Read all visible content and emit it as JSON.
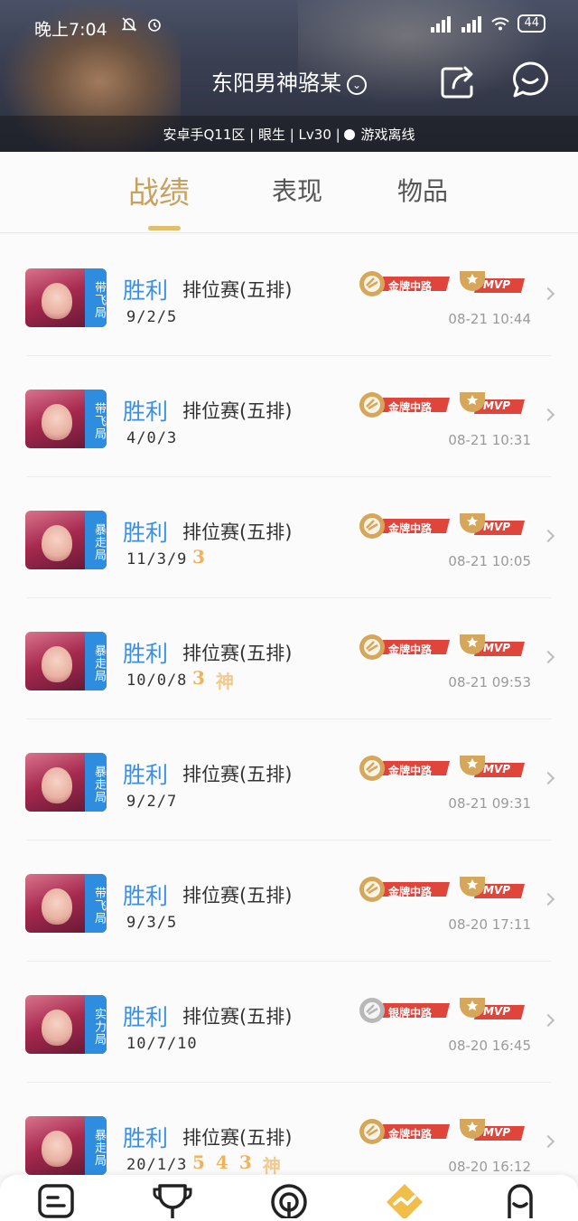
{
  "status_bar": {
    "time": "晚上7:04",
    "battery": "44"
  },
  "profile": {
    "name": "东阳男神骆某",
    "subtitle": "安卓手Q11区 | 眼生 | Lv30 |",
    "game_status": "游戏离线"
  },
  "tabs": [
    {
      "label": "战绩",
      "active": true
    },
    {
      "label": "表现",
      "active": false
    },
    {
      "label": "物品",
      "active": false
    }
  ],
  "matches": [
    {
      "tag": "带飞局",
      "tag_color": "#2f8de0",
      "result": "胜利",
      "mode": "排位赛(五排)",
      "kda": "9/2/5",
      "streaks": [],
      "lane_badge": "金牌中路",
      "lane_tier": "gold",
      "mvp": "MVP",
      "time": "08-21 10:44"
    },
    {
      "tag": "带飞局",
      "tag_color": "#2f8de0",
      "result": "胜利",
      "mode": "排位赛(五排)",
      "kda": "4/0/3",
      "streaks": [],
      "lane_badge": "金牌中路",
      "lane_tier": "gold",
      "mvp": "MVP",
      "time": "08-21 10:31"
    },
    {
      "tag": "暴走局",
      "tag_color": "#2f8de0",
      "result": "胜利",
      "mode": "排位赛(五排)",
      "kda": "11/3/9",
      "streaks": [
        "3"
      ],
      "lane_badge": "金牌中路",
      "lane_tier": "gold",
      "mvp": "MVP",
      "time": "08-21 10:05"
    },
    {
      "tag": "暴走局",
      "tag_color": "#2f8de0",
      "result": "胜利",
      "mode": "排位赛(五排)",
      "kda": "10/0/8",
      "streaks": [
        "3",
        "神"
      ],
      "lane_badge": "金牌中路",
      "lane_tier": "gold",
      "mvp": "MVP",
      "time": "08-21 09:53"
    },
    {
      "tag": "暴走局",
      "tag_color": "#2f8de0",
      "result": "胜利",
      "mode": "排位赛(五排)",
      "kda": "9/2/7",
      "streaks": [],
      "lane_badge": "金牌中路",
      "lane_tier": "gold",
      "mvp": "MVP",
      "time": "08-21 09:31"
    },
    {
      "tag": "带飞局",
      "tag_color": "#2f8de0",
      "result": "胜利",
      "mode": "排位赛(五排)",
      "kda": "9/3/5",
      "streaks": [],
      "lane_badge": "金牌中路",
      "lane_tier": "gold",
      "mvp": "MVP",
      "time": "08-20 17:11"
    },
    {
      "tag": "实力局",
      "tag_color": "#2f8de0",
      "result": "胜利",
      "mode": "排位赛(五排)",
      "kda": "10/7/10",
      "streaks": [],
      "lane_badge": "银牌中路",
      "lane_tier": "silver",
      "mvp": "MVP",
      "time": "08-20 16:45"
    },
    {
      "tag": "暴走局",
      "tag_color": "#2f8de0",
      "result": "胜利",
      "mode": "排位赛(五排)",
      "kda": "20/1/3",
      "streaks": [
        "5",
        "4",
        "3",
        "神"
      ],
      "lane_badge": "金牌中路",
      "lane_tier": "gold",
      "mvp": "MVP",
      "time": "08-20 16:12"
    }
  ],
  "colors": {
    "accent": "#c9a15d",
    "win": "#3a8fe0",
    "lane_badge": "#e0453c",
    "mvp_badge": "#e0453c"
  },
  "bottom_nav": [
    {
      "icon": "chat-list-icon"
    },
    {
      "icon": "trophy-icon"
    },
    {
      "icon": "target-icon"
    },
    {
      "icon": "trend-diamond-icon",
      "active": true
    },
    {
      "icon": "profile-icon"
    }
  ]
}
